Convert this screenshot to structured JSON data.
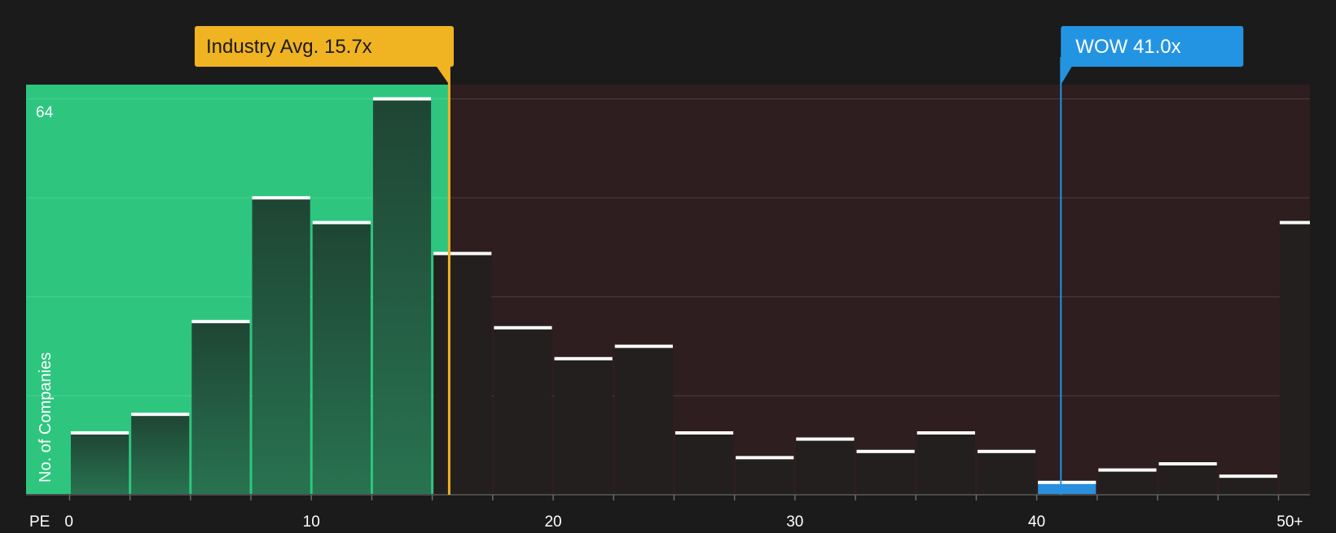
{
  "chart_data": {
    "type": "bar",
    "title": "",
    "xlabel": "PE",
    "ylabel": "No. of Companies",
    "y_max_label": "64",
    "ylim": [
      0,
      66.3
    ],
    "x_range": [
      -1.8,
      51.3
    ],
    "bin_width": 2.5,
    "bins": [
      {
        "start": 0,
        "count": 10
      },
      {
        "start": 2.5,
        "count": 13
      },
      {
        "start": 5,
        "count": 28
      },
      {
        "start": 7.5,
        "count": 48
      },
      {
        "start": 10,
        "count": 44
      },
      {
        "start": 12.5,
        "count": 64
      },
      {
        "start": 15,
        "count": 39
      },
      {
        "start": 17.5,
        "count": 27
      },
      {
        "start": 20,
        "count": 22
      },
      {
        "start": 22.5,
        "count": 24
      },
      {
        "start": 25,
        "count": 10
      },
      {
        "start": 27.5,
        "count": 6
      },
      {
        "start": 30,
        "count": 9
      },
      {
        "start": 32.5,
        "count": 7
      },
      {
        "start": 35,
        "count": 10
      },
      {
        "start": 37.5,
        "count": 7
      },
      {
        "start": 40,
        "count": 2,
        "highlight": true
      },
      {
        "start": 42.5,
        "count": 4
      },
      {
        "start": 45,
        "count": 5
      },
      {
        "start": 47.5,
        "count": 3
      },
      {
        "start": 50,
        "count": 44
      }
    ],
    "x_ticks": [
      {
        "value": 0,
        "label": "0"
      },
      {
        "value": 10,
        "label": "10"
      },
      {
        "value": 20,
        "label": "20"
      },
      {
        "value": 30,
        "label": "30"
      },
      {
        "value": 40,
        "label": "40"
      },
      {
        "value": 50,
        "label": "50+"
      }
    ],
    "industry_avg": {
      "value": 15.7,
      "label": "Industry Avg. 15.7x"
    },
    "company": {
      "value": 41.0,
      "label": "WOW 41.0x"
    },
    "colors": {
      "background": "#1b1b1b",
      "undervalued_zone": "#2ec67f",
      "overvalued_zone": "#2e1e1f",
      "bar_in_green_top": "#1f4534",
      "bar_in_green_bottom": "#287350",
      "bar_dark": "#241f1f",
      "bar_cap": "#ffffff",
      "highlight_bar": "#2a8fdc",
      "industry": "#f0b322",
      "company": "#2394e2",
      "axis_text": "#ffffff"
    }
  }
}
